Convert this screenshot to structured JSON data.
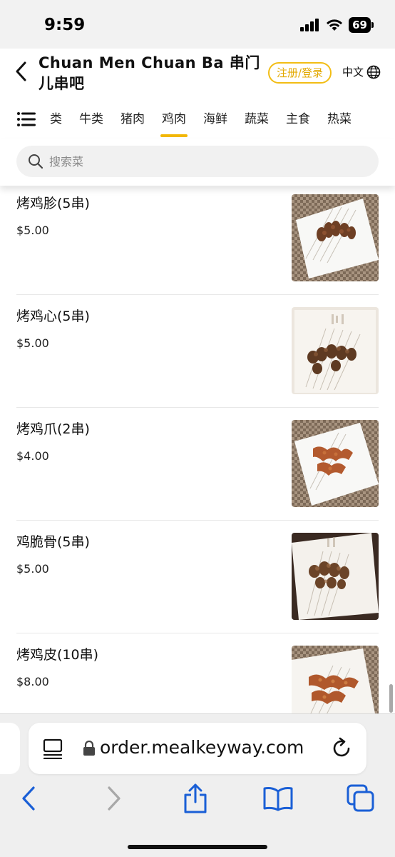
{
  "status": {
    "time": "9:59",
    "battery": "69"
  },
  "header": {
    "restaurant_name": "Chuan Men Chuan Ba 串门儿串吧",
    "login_label": "注册/登录",
    "language_label": "中文"
  },
  "categories": [
    "类",
    "牛类",
    "猪肉",
    "鸡肉",
    "海鲜",
    "蔬菜",
    "主食",
    "热菜"
  ],
  "active_category": "鸡肉",
  "search": {
    "placeholder": "搜索菜"
  },
  "items": [
    {
      "name": "烤鸡胗(5串)",
      "price": "$5.00"
    },
    {
      "name": "烤鸡心(5串)",
      "price": "$5.00"
    },
    {
      "name": "烤鸡爪(2串)",
      "price": "$4.00"
    },
    {
      "name": "鸡脆骨(5串)",
      "price": "$5.00"
    },
    {
      "name": "烤鸡皮(10串)",
      "price": "$8.00"
    }
  ],
  "browser": {
    "url": "order.mealkeyway.com"
  },
  "colors": {
    "accent": "#f2b705",
    "link_blue": "#1a5fd6"
  },
  "icons": [
    "back-icon",
    "globe-icon",
    "menu-icon",
    "search-icon",
    "reader-icon",
    "lock-icon",
    "reload-icon",
    "share-icon",
    "bookmarks-icon",
    "tabs-icon"
  ]
}
